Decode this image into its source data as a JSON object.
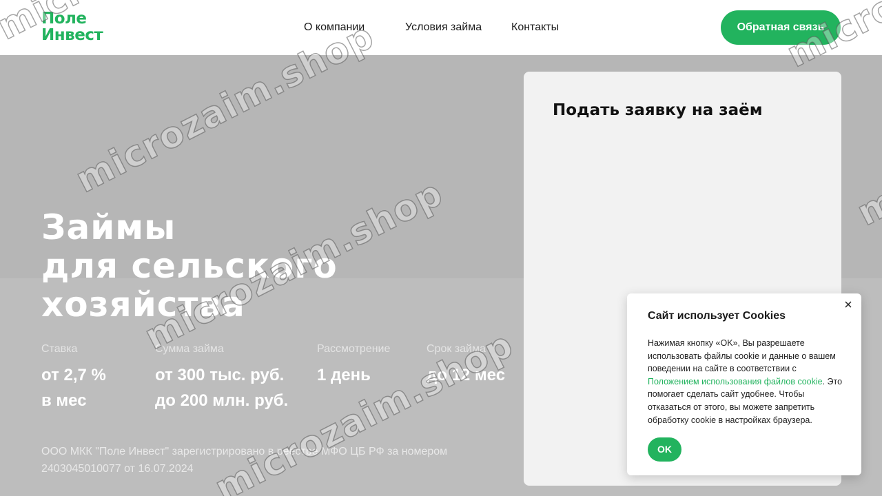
{
  "header": {
    "logo_line1": "Поле",
    "logo_line2": "Инвест",
    "nav": [
      "О компании",
      "Условия займа",
      "Контакты"
    ],
    "cta_label": "Обратная связь"
  },
  "hero": {
    "title_lines": [
      "Займы",
      "для сельского",
      "хозяйства"
    ],
    "stats": [
      {
        "label": "Ставка",
        "value_line1": "от 2,7 %",
        "value_line2": "в мес"
      },
      {
        "label": "Сумма займа",
        "value_line1": "от 300 тыс. руб.",
        "value_line2": "до 200 млн. руб."
      },
      {
        "label": "Рассмотрение",
        "value_line1": "1 день",
        "value_line2": ""
      },
      {
        "label": "Срок займа",
        "value_line1": "до 12 мес",
        "value_line2": ""
      }
    ],
    "legal_text": "ООО МКК \"Поле Инвест\" зарегистрировано в реестре МФО ЦБ РФ за номером 2403045010077 от 16.07.2024"
  },
  "form": {
    "title": "Подать заявку на заём"
  },
  "cookie": {
    "title": "Сайт использует Cookies",
    "text_before_link": "Нажимая кнопку «OK», Вы разрешаете использовать файлы cookie и данные о вашем поведении на сайте в соответствии с ",
    "link_text": "Положением использования файлов cookie",
    "text_after_link": ". Это помогает сделать сайт удобнее. Чтобы отказаться от этого, вы можете запретить обработку cookie в настройках браузера.",
    "ok_label": "OK"
  },
  "watermark": "microzaim.shop",
  "colors": {
    "brand_green": "#22b35e",
    "hero_bg": "#b9b9b9",
    "card_bg": "#f2f2f2"
  }
}
